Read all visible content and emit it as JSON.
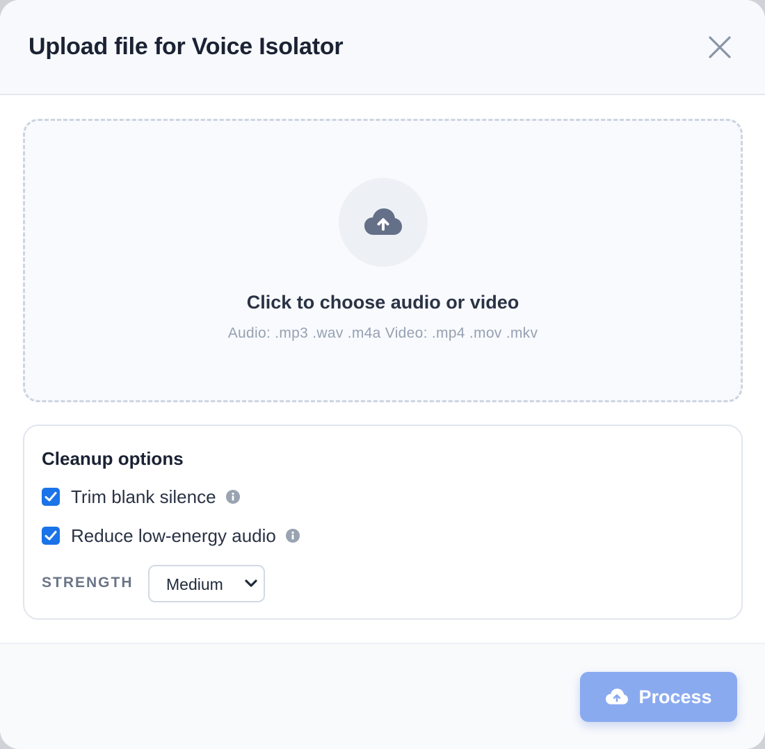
{
  "modal": {
    "title": "Upload file for Voice Isolator",
    "close_icon": "close-icon"
  },
  "dropzone": {
    "title": "Click to choose audio or video",
    "formats": "Audio: .mp3 .wav .m4a Video: .mp4 .mov .mkv",
    "icon": "cloud-upload-icon"
  },
  "options": {
    "title": "Cleanup options",
    "items": [
      {
        "label": "Trim blank silence",
        "checked": true,
        "icon": "info-icon"
      },
      {
        "label": "Reduce low-energy audio",
        "checked": true,
        "icon": "info-icon"
      }
    ],
    "strength": {
      "label": "STRENGTH",
      "value": "Medium"
    }
  },
  "footer": {
    "process_label": "Process",
    "process_icon": "cloud-upload-icon"
  },
  "colors": {
    "accent": "#1a73e8",
    "process_button": "#8aaaf0",
    "title_text": "#1a2233",
    "muted_text": "#97a1b2"
  }
}
